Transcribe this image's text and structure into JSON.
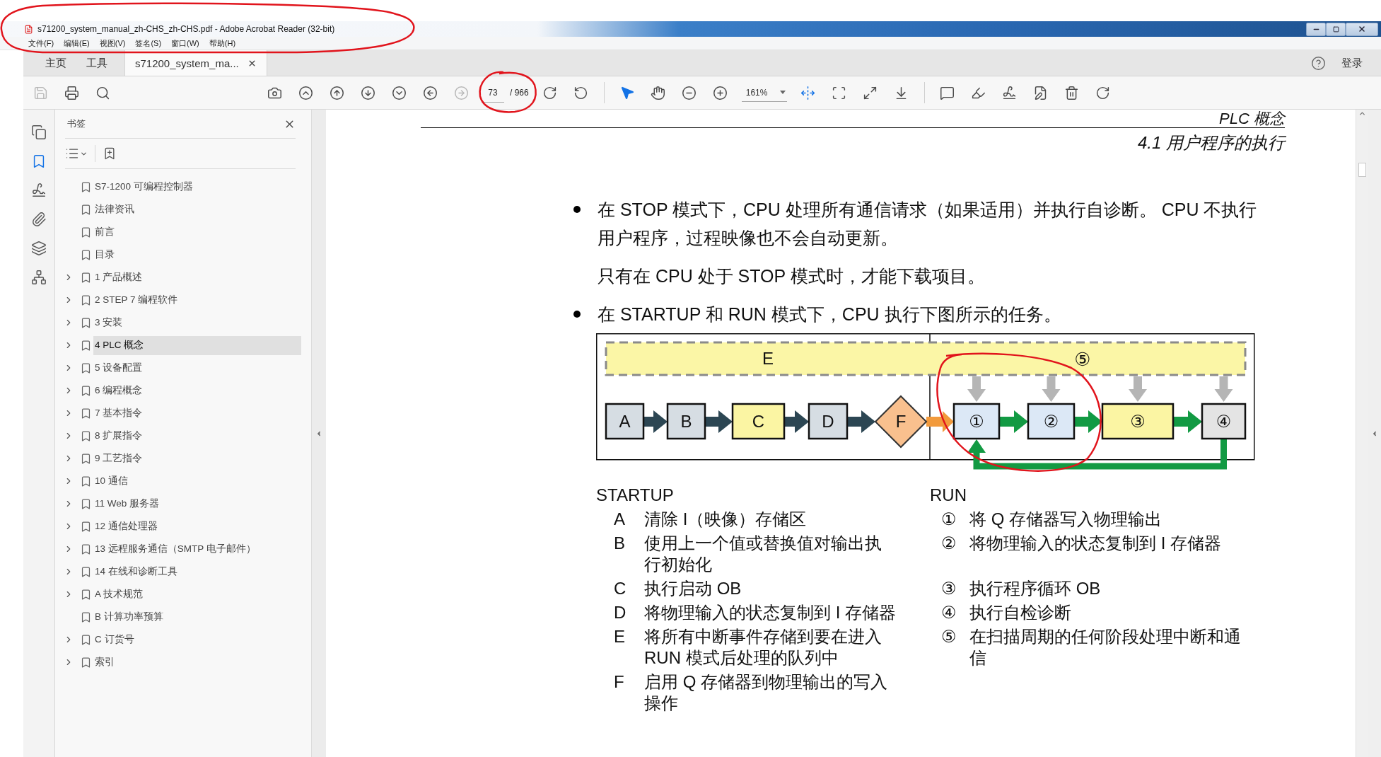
{
  "window": {
    "title": "s71200_system_manual_zh-CHS_zh-CHS.pdf - Adobe Acrobat Reader (32-bit)"
  },
  "menu": [
    "文件(F)",
    "编辑(E)",
    "视图(V)",
    "签名(S)",
    "窗口(W)",
    "帮助(H)"
  ],
  "tabs": [
    {
      "label": "主页",
      "selected": false
    },
    {
      "label": "工具",
      "selected": false
    },
    {
      "label": "s71200_system_ma...",
      "selected": true
    }
  ],
  "account": {
    "sign_in": "登录"
  },
  "toolbar": [
    {
      "kind": "save",
      "active": false,
      "disabled": true
    },
    {
      "kind": "print",
      "active": false,
      "disabled": false
    },
    {
      "kind": "find",
      "active": false,
      "disabled": false
    },
    {
      "kind": "snapshot",
      "active": false,
      "disabled": false
    },
    {
      "kind": "first-page",
      "active": false,
      "disabled": false
    },
    {
      "kind": "previous-page",
      "active": false,
      "disabled": false
    },
    {
      "kind": "next-page",
      "active": false,
      "disabled": false
    },
    {
      "kind": "last-page",
      "active": false,
      "disabled": false
    },
    {
      "kind": "back",
      "active": false,
      "disabled": false
    },
    {
      "kind": "forward",
      "active": false,
      "disabled": true
    },
    {
      "kind": "page",
      "value": "73",
      "total": "/ 966"
    },
    {
      "kind": "rotate-clockwise",
      "active": false,
      "disabled": false
    },
    {
      "kind": "rotate-counterclockwise",
      "active": false,
      "disabled": false
    },
    {
      "kind": "separator"
    },
    {
      "kind": "select",
      "active": true,
      "disabled": false
    },
    {
      "kind": "hand",
      "active": false,
      "disabled": false
    },
    {
      "kind": "zoom-out",
      "active": false,
      "disabled": false
    },
    {
      "kind": "zoom-in",
      "active": false,
      "disabled": false
    },
    {
      "kind": "zoom",
      "value": "161%"
    },
    {
      "kind": "fit-width",
      "active": true,
      "disabled": false
    },
    {
      "kind": "fit-page",
      "active": false,
      "disabled": false
    },
    {
      "kind": "full-screen",
      "active": false,
      "disabled": false
    },
    {
      "kind": "read-mode",
      "active": false,
      "disabled": false
    },
    {
      "kind": "separator"
    },
    {
      "kind": "comment",
      "active": false,
      "disabled": false
    },
    {
      "kind": "highlight",
      "active": false,
      "disabled": false
    },
    {
      "kind": "sign",
      "active": false,
      "disabled": false
    },
    {
      "kind": "edit",
      "active": false,
      "disabled": false
    },
    {
      "kind": "delete",
      "active": false,
      "disabled": false
    },
    {
      "kind": "redo",
      "active": false,
      "disabled": false
    }
  ],
  "rail": [
    {
      "kind": "pages",
      "selected": false
    },
    {
      "kind": "bookmarks",
      "selected": true
    },
    {
      "kind": "signatures",
      "selected": false
    },
    {
      "kind": "attachments",
      "selected": false
    },
    {
      "kind": "layers",
      "selected": false
    },
    {
      "kind": "structure",
      "selected": false
    }
  ],
  "bookmarks": {
    "title": "书签",
    "items": [
      {
        "label": "S7-1200 可编程控制器",
        "expandable": false,
        "selected": false
      },
      {
        "label": "法律资讯",
        "expandable": false,
        "selected": false
      },
      {
        "label": "前言",
        "expandable": false,
        "selected": false
      },
      {
        "label": "目录",
        "expandable": false,
        "selected": false
      },
      {
        "label": "1 产品概述",
        "expandable": true,
        "selected": false
      },
      {
        "label": "2 STEP 7 编程软件",
        "expandable": true,
        "selected": false
      },
      {
        "label": "3 安装",
        "expandable": true,
        "selected": false
      },
      {
        "label": "4 PLC 概念",
        "expandable": true,
        "selected": true
      },
      {
        "label": "5 设备配置",
        "expandable": true,
        "selected": false
      },
      {
        "label": "6 编程概念",
        "expandable": true,
        "selected": false
      },
      {
        "label": "7 基本指令",
        "expandable": true,
        "selected": false
      },
      {
        "label": "8 扩展指令",
        "expandable": true,
        "selected": false
      },
      {
        "label": "9 工艺指令",
        "expandable": true,
        "selected": false
      },
      {
        "label": "10 通信",
        "expandable": true,
        "selected": false
      },
      {
        "label": "11 Web 服务器",
        "expandable": true,
        "selected": false
      },
      {
        "label": "12 通信处理器",
        "expandable": true,
        "selected": false
      },
      {
        "label": "13 远程服务通信（SMTP 电子邮件）",
        "expandable": true,
        "selected": false
      },
      {
        "label": "14 在线和诊断工具",
        "expandable": true,
        "selected": false
      },
      {
        "label": "A 技术规范",
        "expandable": true,
        "selected": false
      },
      {
        "label": "B 计算功率预算",
        "expandable": false,
        "selected": false
      },
      {
        "label": "C 订货号",
        "expandable": true,
        "selected": false
      },
      {
        "label": "索引",
        "expandable": true,
        "selected": false
      }
    ]
  },
  "document": {
    "running_head": "PLC 概念",
    "section": "4.1 用户程序的执行",
    "blocks": [
      {
        "kind": "bullet",
        "text": "在 STOP 模式下，CPU 处理所有通信请求（如果适用）并执行自诊断。 CPU 不执行用户程序，过程映像也不会自动更新。"
      },
      {
        "kind": "paragraph",
        "text": "只有在 CPU 处于 STOP 模式时，才能下载项目。"
      },
      {
        "kind": "bullet",
        "text": "在 STARTUP 和 RUN 模式下，CPU 执行下图所示的任务。"
      }
    ],
    "figure": {
      "band_label": "E",
      "band_marker": "⑤",
      "startup_steps": [
        {
          "label": "A",
          "kind": "box",
          "color": "#d6dde3"
        },
        {
          "label": "B",
          "kind": "box",
          "color": "#d6dde3"
        },
        {
          "label": "C",
          "kind": "box",
          "color": "#fbf5a3"
        },
        {
          "label": "D",
          "kind": "box",
          "color": "#d6dde3"
        },
        {
          "label": "F",
          "kind": "diamond",
          "color": "#f9c08e"
        }
      ],
      "run_steps": [
        {
          "label": "①",
          "kind": "box",
          "color": "#dce8f6"
        },
        {
          "label": "②",
          "kind": "box",
          "color": "#dce8f6"
        },
        {
          "label": "③",
          "kind": "box",
          "color": "#fbf5a3"
        },
        {
          "label": "④",
          "kind": "box",
          "color": "#e4e4e4"
        }
      ]
    },
    "legend": {
      "startup": {
        "heading": "STARTUP",
        "items": [
          {
            "key": "A",
            "text": "清除 I（映像）存储区"
          },
          {
            "key": "B",
            "text": "使用上一个值或替换值对输出执行初始化"
          },
          {
            "key": "C",
            "text": "执行启动 OB"
          },
          {
            "key": "D",
            "text": "将物理输入的状态复制到 I 存储器"
          },
          {
            "key": "E",
            "text": "将所有中断事件存储到要在进入 RUN 模式后处理的队列中"
          },
          {
            "key": "F",
            "text": "启用 Q 存储器到物理输出的写入操作"
          }
        ]
      },
      "run": {
        "heading": "RUN",
        "items": [
          {
            "key": "①",
            "text": "将 Q 存储器写入物理输出"
          },
          {
            "key": "②",
            "text": "将物理输入的状态复制到 I 存储器"
          },
          {
            "key": "③",
            "text": "执行程序循环 OB"
          },
          {
            "key": "④",
            "text": "执行自检诊断"
          },
          {
            "key": "⑤",
            "text": "在扫描周期的任何阶段处理中断和通信"
          }
        ]
      }
    }
  }
}
